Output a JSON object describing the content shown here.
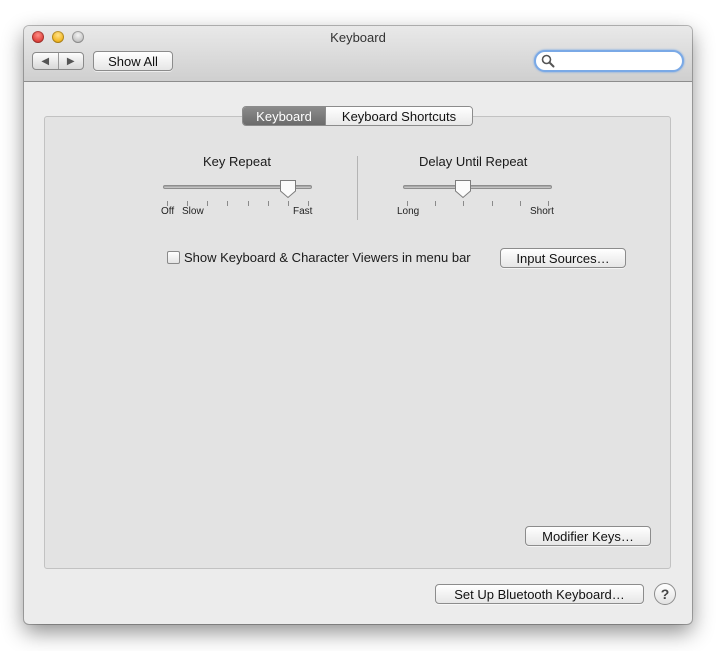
{
  "window": {
    "title": "Keyboard"
  },
  "toolbar": {
    "back_icon": "◀",
    "forward_icon": "▶",
    "show_all_label": "Show All",
    "search_value": "",
    "search_placeholder": ""
  },
  "tabs": [
    {
      "label": "Keyboard",
      "selected": true
    },
    {
      "label": "Keyboard Shortcuts",
      "selected": false
    }
  ],
  "key_repeat": {
    "label": "Key Repeat",
    "min_label_off": "Off",
    "min_label_slow": "Slow",
    "max_label": "Fast",
    "ticks": 8,
    "value_fraction": 0.857
  },
  "delay_until_repeat": {
    "label": "Delay Until Repeat",
    "min_label": "Long",
    "max_label": "Short",
    "ticks": 6,
    "value_fraction": 0.4
  },
  "viewers_checkbox": {
    "label": "Show Keyboard & Character Viewers in menu bar",
    "checked": false
  },
  "buttons": {
    "input_sources": "Input Sources…",
    "modifier_keys": "Modifier Keys…",
    "bluetooth_keyboard": "Set Up Bluetooth Keyboard…",
    "help": "?"
  },
  "colors": {
    "selected_tab": "#7a7a7a",
    "search_focus_ring": "#7aa9e6",
    "close_button": "#e0443e",
    "minimize_button": "#f2b824"
  }
}
